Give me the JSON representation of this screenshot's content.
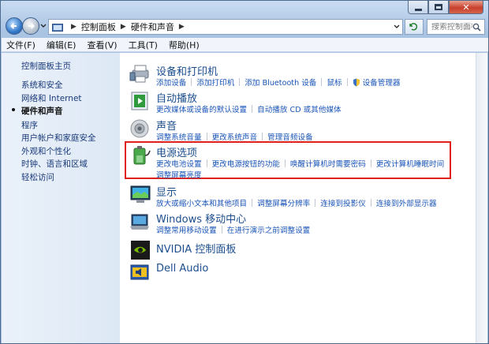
{
  "window": {
    "caption": {
      "minimize": "minimize",
      "maximize": "maximize",
      "close": "close"
    }
  },
  "address": {
    "crumbs": [
      "控制面板",
      "硬件和声音"
    ]
  },
  "search": {
    "placeholder": "搜索控制面板"
  },
  "menu": [
    "文件(F)",
    "编辑(E)",
    "查看(V)",
    "工具(T)",
    "帮助(H)"
  ],
  "sidebar": {
    "items": [
      {
        "label": "控制面板主页",
        "current": false
      },
      {
        "label": "系统和安全",
        "current": false
      },
      {
        "label": "网络和 Internet",
        "current": false
      },
      {
        "label": "硬件和声音",
        "current": true
      },
      {
        "label": "程序",
        "current": false
      },
      {
        "label": "用户帐户和家庭安全",
        "current": false
      },
      {
        "label": "外观和个性化",
        "current": false
      },
      {
        "label": "时钟、语言和区域",
        "current": false
      },
      {
        "label": "轻松访问",
        "current": false
      }
    ]
  },
  "categories": [
    {
      "title": "设备和打印机",
      "icon": "printer-icon",
      "rows": [
        [
          "添加设备",
          "添加打印机",
          "添加 Bluetooth 设备",
          "鼠标",
          "设备管理器"
        ]
      ]
    },
    {
      "title": "自动播放",
      "icon": "autoplay-icon",
      "rows": [
        [
          "更改媒体或设备的默认设置",
          "自动播放 CD 或其他媒体"
        ]
      ]
    },
    {
      "title": "声音",
      "icon": "speaker-icon",
      "rows": [
        [
          "调整系统音量",
          "更改系统声音",
          "管理音频设备"
        ]
      ]
    },
    {
      "title": "电源选项",
      "icon": "power-options-icon",
      "rows": [
        [
          "更改电池设置",
          "更改电源按钮的功能",
          "唤醒计算机时需要密码",
          "更改计算机睡眠时间"
        ],
        [
          "调整屏幕亮度"
        ]
      ]
    },
    {
      "title": "显示",
      "icon": "display-icon",
      "rows": [
        [
          "放大或缩小文本和其他项目",
          "调整屏幕分辨率",
          "连接到投影仪",
          "连接到外部显示器"
        ]
      ]
    },
    {
      "title": "Windows 移动中心",
      "icon": "mobility-center-icon",
      "rows": [
        [
          "调整常用移动设置",
          "在进行演示之前调整设置"
        ]
      ]
    },
    {
      "title": "NVIDIA 控制面板",
      "icon": "nvidia-icon",
      "rows": []
    },
    {
      "title": "Dell Audio",
      "icon": "dell-audio-icon",
      "rows": []
    }
  ],
  "colors": {
    "link": "#1b55b8",
    "title": "#1c4e8e",
    "highlight": "#e0211b"
  }
}
